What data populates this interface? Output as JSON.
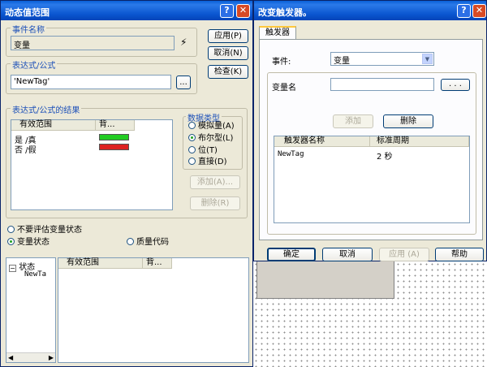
{
  "dialog1": {
    "title": "动态值范围",
    "event_group": "事件名称",
    "event_value": "变量",
    "expr_group": "表达式/公式",
    "expr_value": "'NewTag'",
    "browse": "...",
    "result_group": "表达式/公式的结果",
    "result_cols": [
      "有效范围",
      "背..."
    ],
    "result_rows": [
      {
        "label": "是 /真",
        "color": "#22cc22"
      },
      {
        "label": "否 /假",
        "color": "#dd2222"
      }
    ],
    "datatype_group": "数据类型",
    "datatypes": [
      {
        "label": "模拟量(A)",
        "checked": false
      },
      {
        "label": "布尔型(L)",
        "checked": true
      },
      {
        "label": "位(T)",
        "checked": false
      },
      {
        "label": "直接(D)",
        "checked": false
      }
    ],
    "add": "添加(A)...",
    "delete": "删除(R)",
    "apply": "应用(P)",
    "cancel": "取消(N)",
    "check": "检查(K)",
    "eval_none": "不要评估变量状态",
    "eval_state": "变量状态",
    "quality": "质量代码",
    "tree_root": "状态",
    "tree_child": "NewTa",
    "bottom_cols": [
      "有效范围",
      "背..."
    ]
  },
  "dialog2": {
    "title": "改变触发器。",
    "tab": "触发器",
    "event_label": "事件:",
    "event_value": "变量",
    "var_label": "变量名",
    "browse": ". . .",
    "add": "添加",
    "delete": "删除",
    "cols": [
      "触发器名称",
      "标准周期"
    ],
    "rows": [
      {
        "name": "NewTag",
        "period": "2 秒"
      }
    ],
    "ok": "确定",
    "cancel": "取消",
    "apply": "应用 (A)",
    "help": "帮助"
  },
  "colors": {
    "title": "#0a55cf",
    "panel": "#ece9d8"
  }
}
